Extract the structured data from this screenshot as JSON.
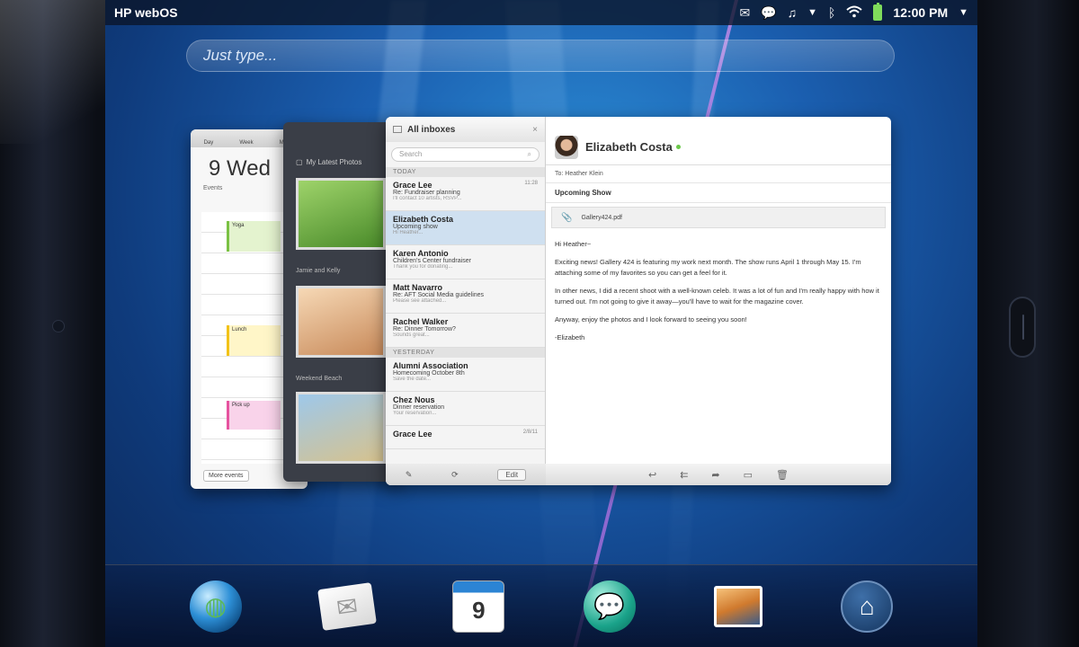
{
  "status_bar": {
    "title": "HP webOS",
    "time": "12:00 PM"
  },
  "search": {
    "placeholder": "Just type..."
  },
  "calendar_card": {
    "toolbar": [
      "Day",
      "Week",
      "Month"
    ],
    "date": "9 Wed",
    "events_label": "Events",
    "events": [
      {
        "title": "Yoga"
      },
      {
        "title": "Lunch"
      },
      {
        "title": "Pick up"
      }
    ],
    "more_button": "More events"
  },
  "photos_card": {
    "albums": [
      {
        "label": "My Latest Photos"
      },
      {
        "label": "Jamie and Kelly"
      },
      {
        "label": "Weekend Beach"
      }
    ]
  },
  "email_card": {
    "inbox_title": "All inboxes",
    "search_placeholder": "Search",
    "sections": {
      "today": "TODAY",
      "yesterday": "YESTERDAY"
    },
    "messages_today": [
      {
        "from": "Grace Lee",
        "subject": "Re: Fundraiser planning",
        "preview": "I'll contact 10 artists, RSVP...",
        "time": "11:28"
      },
      {
        "from": "Elizabeth Costa",
        "subject": "Upcoming show",
        "preview": "Hi Heather...",
        "time": ""
      },
      {
        "from": "Karen Antonio",
        "subject": "Children's Center fundraiser",
        "preview": "Thank you for donating...",
        "time": ""
      },
      {
        "from": "Matt Navarro",
        "subject": "Re: AFT Social Media guidelines",
        "preview": "Please see attached...",
        "time": ""
      },
      {
        "from": "Rachel Walker",
        "subject": "Re: Dinner Tomorrow?",
        "preview": "Sounds great...",
        "time": ""
      }
    ],
    "messages_yesterday": [
      {
        "from": "Alumni Association",
        "subject": "Homecoming October 8th",
        "preview": "Save the date...",
        "time": ""
      },
      {
        "from": "Chez Nous",
        "subject": "Dinner reservation",
        "preview": "Your reservation...",
        "time": ""
      },
      {
        "from": "Grace Lee",
        "subject": "",
        "preview": "",
        "time": "2/8/11"
      }
    ],
    "edit_button": "Edit",
    "reader": {
      "sender": "Elizabeth Costa",
      "to_label": "To:",
      "to_value": "Heather Klein",
      "subject": "Upcoming Show",
      "attachment": "Gallery424.pdf",
      "body": [
        "Hi Heather~",
        "Exciting news! Gallery 424 is featuring my work next month. The show runs April 1 through May 15. I'm attaching some of my favorites so you can get a feel for it.",
        "In other news, I did a recent shoot with a well-known celeb. It was a lot of fun and I'm really happy with how it turned out. I'm not going to give it away—you'll have to wait for the magazine cover.",
        "Anyway, enjoy the photos and I look forward to seeing you soon!",
        "-Elizabeth"
      ]
    }
  },
  "dock": {
    "calendar_day": "9",
    "icons": [
      "web-browser-icon",
      "email-icon",
      "calendar-icon",
      "messaging-icon",
      "photos-icon",
      "launcher-icon"
    ]
  }
}
